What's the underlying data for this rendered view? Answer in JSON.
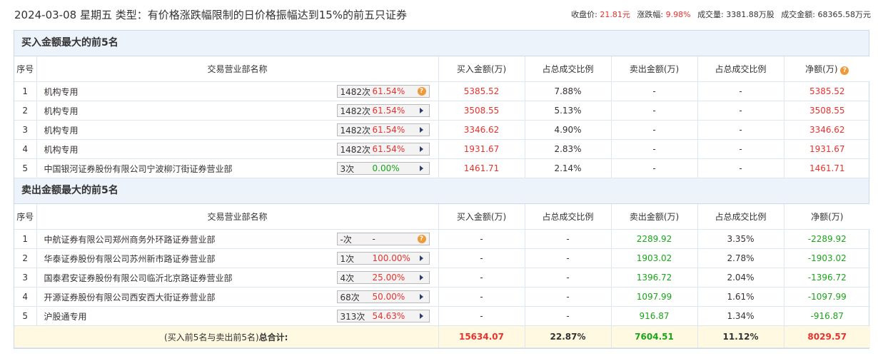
{
  "header": {
    "title": "2024-03-08 星期五 类型：有价格涨跌幅限制的日价格振幅达到15%的前五只证券",
    "close_label": "收盘价:",
    "close_value": "21.81元",
    "change_label": "涨跌幅:",
    "change_value": "9.98%",
    "volume_label": "成交量:",
    "volume_value": "3381.88万股",
    "turnover_label": "成交金额:",
    "turnover_value": "68365.58万元"
  },
  "columns": {
    "seq": "序号",
    "name": "交易营业部名称",
    "buy": "买入金额(万)",
    "buy_ratio": "占总成交比例",
    "sell": "卖出金额(万)",
    "sell_ratio": "占总成交比例",
    "net": "净额(万)"
  },
  "buy_section": {
    "title": "买入金额最大的前5名",
    "rows": [
      {
        "seq": "1",
        "name": "机构专用",
        "count": "1482次",
        "pct": "61.54%",
        "buy": "5385.52",
        "buy_ratio": "7.88%",
        "sell": "-",
        "sell_ratio": "-",
        "net": "5385.52"
      },
      {
        "seq": "2",
        "name": "机构专用",
        "count": "1482次",
        "pct": "61.54%",
        "buy": "3508.55",
        "buy_ratio": "5.13%",
        "sell": "-",
        "sell_ratio": "-",
        "net": "3508.55"
      },
      {
        "seq": "3",
        "name": "机构专用",
        "count": "1482次",
        "pct": "61.54%",
        "buy": "3346.62",
        "buy_ratio": "4.90%",
        "sell": "-",
        "sell_ratio": "-",
        "net": "3346.62"
      },
      {
        "seq": "4",
        "name": "机构专用",
        "count": "1482次",
        "pct": "61.54%",
        "buy": "1931.67",
        "buy_ratio": "2.83%",
        "sell": "-",
        "sell_ratio": "-",
        "net": "1931.67"
      },
      {
        "seq": "5",
        "name": "中国银河证券股份有限公司宁波柳汀街证券营业部",
        "count": "3次",
        "pct": "0.00%",
        "buy": "1461.71",
        "buy_ratio": "2.14%",
        "sell": "-",
        "sell_ratio": "-",
        "net": "1461.71"
      }
    ]
  },
  "sell_section": {
    "title": "卖出金额最大的前5名",
    "rows": [
      {
        "seq": "1",
        "name": "中航证券有限公司郑州商务外环路证券营业部",
        "count": "-次",
        "pct": "-",
        "buy": "-",
        "buy_ratio": "-",
        "sell": "2289.92",
        "sell_ratio": "3.35%",
        "net": "-2289.92"
      },
      {
        "seq": "2",
        "name": "华泰证券股份有限公司苏州新市路证券营业部",
        "count": "1次",
        "pct": "100.00%",
        "buy": "-",
        "buy_ratio": "-",
        "sell": "1903.02",
        "sell_ratio": "2.78%",
        "net": "-1903.02"
      },
      {
        "seq": "3",
        "name": "国泰君安证券股份有限公司临沂北京路证券营业部",
        "count": "4次",
        "pct": "25.00%",
        "buy": "-",
        "buy_ratio": "-",
        "sell": "1396.72",
        "sell_ratio": "2.04%",
        "net": "-1396.72"
      },
      {
        "seq": "4",
        "name": "开源证券股份有限公司西安西大街证券营业部",
        "count": "68次",
        "pct": "50.00%",
        "buy": "-",
        "buy_ratio": "-",
        "sell": "1097.99",
        "sell_ratio": "1.61%",
        "net": "-1097.99"
      },
      {
        "seq": "5",
        "name": "沪股通专用",
        "count": "313次",
        "pct": "54.63%",
        "buy": "-",
        "buy_ratio": "-",
        "sell": "916.87",
        "sell_ratio": "1.34%",
        "net": "-916.87"
      }
    ]
  },
  "total": {
    "label_prefix": "(买入前5名与卖出前5名)",
    "label_main": "总合计:",
    "buy": "15634.07",
    "buy_ratio": "22.87%",
    "sell": "7604.51",
    "sell_ratio": "11.12%",
    "net": "8029.57"
  },
  "colors": {
    "red": "#e8322e",
    "green": "#1aa51a",
    "section_bg": "#edf3fa",
    "total_bg": "#fff9e1"
  }
}
